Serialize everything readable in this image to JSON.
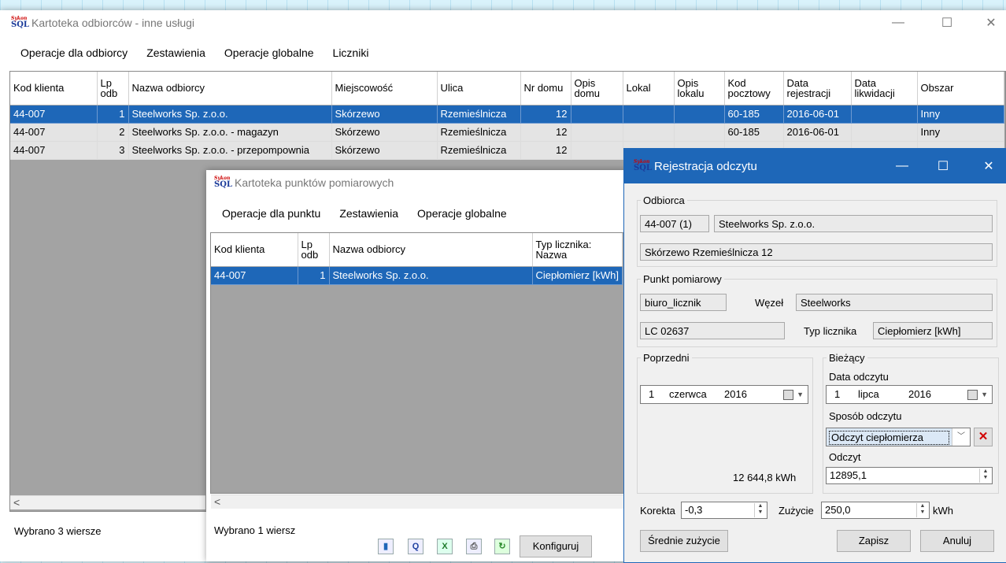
{
  "main_window": {
    "title": "Kartoteka odbiorców - inne usługi",
    "menu": [
      "Operacje dla odbiorcy",
      "Zestawienia",
      "Operacje globalne",
      "Liczniki"
    ],
    "columns": [
      "Kod klienta",
      "Lp odb",
      "Nazwa odbiorcy",
      "Miejscowość",
      "Ulica",
      "Nr domu",
      "Opis domu",
      "Lokal",
      "Opis lokalu",
      "Kod pocztowy",
      "Data rejestracji",
      "Data likwidacji",
      "Obszar"
    ],
    "rows": [
      {
        "kod": "44-007",
        "lp": "1",
        "nazwa": "Steelworks Sp. z.o.o.",
        "miejscowosc": "Skórzewo",
        "ulica": "Rzemieślnicza",
        "nr": "12",
        "opis_domu": "",
        "lokal": "",
        "opis_lokalu": "",
        "kod_poczt": "60-185",
        "data_rej": "2016-06-01",
        "data_lik": "",
        "obszar": "Inny"
      },
      {
        "kod": "44-007",
        "lp": "2",
        "nazwa": "Steelworks Sp. z.o.o. - magazyn",
        "miejscowosc": "Skórzewo",
        "ulica": "Rzemieślnicza",
        "nr": "12",
        "opis_domu": "",
        "lokal": "",
        "opis_lokalu": "",
        "kod_poczt": "60-185",
        "data_rej": "2016-06-01",
        "data_lik": "",
        "obszar": "Inny"
      },
      {
        "kod": "44-007",
        "lp": "3",
        "nazwa": "Steelworks Sp. z.o.o. - przepompownia",
        "miejscowosc": "Skórzewo",
        "ulica": "Rzemieślnicza",
        "nr": "12",
        "opis_domu": "",
        "lokal": "",
        "opis_lokalu": "",
        "kod_poczt": "",
        "data_rej": "",
        "data_lik": "",
        "obszar": ""
      }
    ],
    "status": "Wybrano 3 wiersze"
  },
  "points_window": {
    "title": "Kartoteka punktów pomiarowych",
    "menu": [
      "Operacje dla punktu",
      "Zestawienia",
      "Operacje globalne"
    ],
    "columns": [
      "Kod klienta",
      "Lp odb",
      "Nazwa odbiorcy",
      "Typ licznika: Nazwa"
    ],
    "rows": [
      {
        "kod": "44-007",
        "lp": "1",
        "nazwa": "Steelworks Sp. z.o.o.",
        "typ": "Ciepłomierz [kWh]"
      }
    ],
    "status": "Wybrano 1 wiersz",
    "configure_label": "Konfiguruj",
    "toolbar_icons": [
      "chart-icon",
      "query-icon",
      "excel-icon",
      "print-icon",
      "refresh-icon"
    ]
  },
  "dialog": {
    "title": "Rejestracja odczytu",
    "odbiorca": {
      "legend": "Odbiorca",
      "kod": "44-007 (1)",
      "nazwa": "Steelworks Sp. z.o.o.",
      "adres": "Skórzewo Rzemieślnicza 12"
    },
    "punkt": {
      "legend": "Punkt pomiarowy",
      "nazwa": "biuro_licznik",
      "wezel_label": "Węzeł",
      "wezel": "Steelworks",
      "numer": "LC 02637",
      "typ_label": "Typ licznika",
      "typ": "Ciepłomierz [kWh]"
    },
    "poprzedni": {
      "legend": "Poprzedni",
      "day": "1",
      "month": "czerwca",
      "year": "2016",
      "value": "12 644,8 kWh"
    },
    "biezacy": {
      "legend": "Bieżący",
      "data_label": "Data odczytu",
      "day": "1",
      "month": "lipca",
      "year": "2016",
      "sposob_label": "Sposób odczytu",
      "sposob": "Odczyt ciepłomierza",
      "odczyt_label": "Odczyt",
      "odczyt": "12895,1"
    },
    "korekta_label": "Korekta",
    "korekta": "-0,3",
    "zuzycie_label": "Zużycie",
    "zuzycie": "250,0",
    "unit": "kWh",
    "srednie_label": "Średnie zużycie",
    "zapisz_label": "Zapisz",
    "anuluj_label": "Anuluj"
  },
  "colors": {
    "selection": "#1e67b8",
    "dialog_title": "#1e67b8",
    "delete_red": "#d10000"
  }
}
